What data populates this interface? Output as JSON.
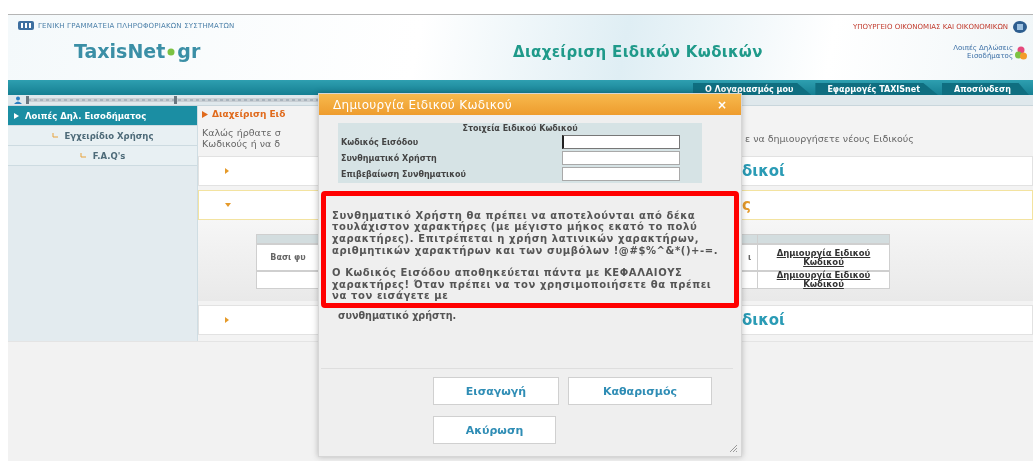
{
  "header": {
    "agency": "ΓΕΝΙΚΗ ΓΡΑΜΜΑΤΕΙΑ ΠΛΗΡΟΦΟΡΙΑΚΩΝ ΣΥΣΤΗΜΑΤΩΝ",
    "logo_name": "TaxisNet",
    "logo_suffix": "gr",
    "title": "Διαχείριση Ειδικών Κωδικών",
    "ministry": "ΥΠΟΥΡΓΕΙΟ ΟΙΚΟΝΟΜΙΑΣ ΚΑΙ ΟΙΚΟΝΟΜΙΚΩΝ",
    "app_badge": "Λοιπές Δηλώσεις Εισοδήματος"
  },
  "nav_tabs": [
    "Ο Λογαριασμός μου",
    "Εφαρμογές TAXISnet",
    "Αποσύνδεση"
  ],
  "sidebar": {
    "items": [
      {
        "label": "Λοιπές Δηλ. Εισοδήματος",
        "selected": true
      },
      {
        "label": "Εγχειρίδιο Χρήσης",
        "selected": false
      },
      {
        "label": "F.A.Q's",
        "selected": false
      }
    ]
  },
  "breadcrumb": "Διαχείριση Ειδ",
  "welcome": {
    "left_lines": [
      "Καλώς ήρθατε σ",
      "Κωδικούς ή να δ"
    ],
    "right": "ε να δημιουργήσετε νέους Ειδικούς"
  },
  "sections": [
    {
      "title": "δικοί",
      "expanded": false
    },
    {
      "title": "ς",
      "expanded": true,
      "table": {
        "rows": [
          {
            "column_1": "Βασι φυ",
            "column_2": "ι",
            "action": "Δημιουργία Ειδικού Κωδικού"
          },
          {
            "action": "Δημιουργία Ειδικού Κωδικού"
          }
        ]
      }
    },
    {
      "title": "δικοί",
      "expanded": false
    }
  ],
  "dialog": {
    "title": "Δημιουργία Ειδικού Κωδικού",
    "close": "×",
    "form": {
      "heading": "Στοιχεία Ειδικού Κωδικού",
      "fields": [
        {
          "label": "Κωδικός Εισόδου",
          "focused": true
        },
        {
          "label": "Συνθηματικό Χρήστη",
          "focused": false
        },
        {
          "label": "Επιβεβαίωση Συνθηματικού",
          "focused": false
        }
      ]
    },
    "notice": {
      "paragraphs": [
        "Συνθηματικό Χρήστη θα πρέπει να αποτελούνται από δέκα τουλάχιστον χαρακτήρες (με μέγιστο μήκος εκατό το πολύ χαρακτήρες). Επιτρέπεται η χρήση λατινικών χαρακτήρων, αριθμητικών χαρακτήρων και των συμβόλων !@#$%^&*()+-=.",
        "Ο Κωδικός Εισόδου αποθηκεύεται πάντα με ΚΕΦΑΛΑΙΟΥΣ χαρακτήρες! Όταν πρέπει να τον χρησιμοποιήσετε θα πρέπει να τον εισάγετε με"
      ],
      "after": "συνθηματικό χρήστη."
    },
    "buttons": [
      "Εισαγωγή",
      "Καθαρισμός",
      "Ακύρωση"
    ]
  }
}
